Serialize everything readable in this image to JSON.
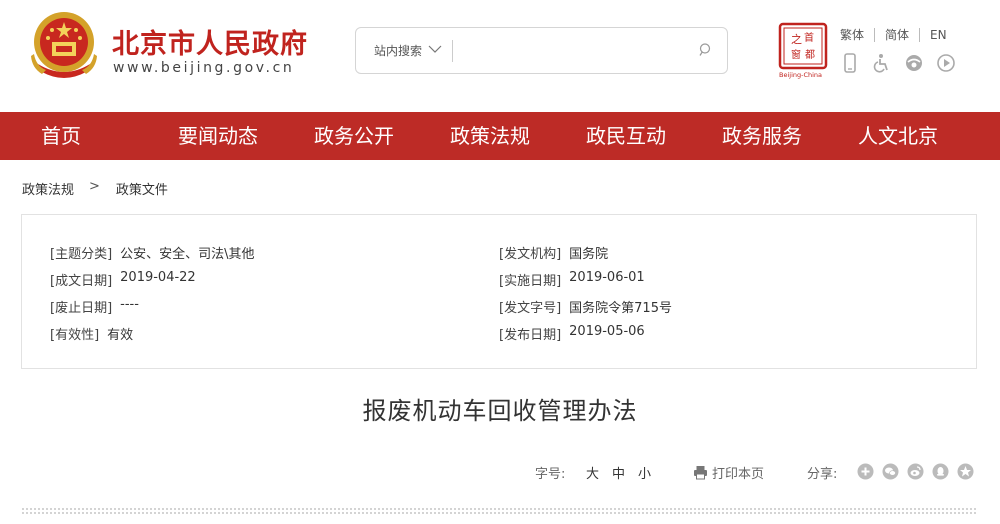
{
  "header": {
    "site_title": "北京市人民政府",
    "site_url": "www.beijing.gov.cn",
    "search": {
      "scope_label": "站内搜索",
      "placeholder": ""
    },
    "capital_logo_text": "Beijing-China",
    "languages": [
      "繁体",
      "简体",
      "EN"
    ]
  },
  "nav": {
    "items": [
      "首页",
      "要闻动态",
      "政务公开",
      "政策法规",
      "政民互动",
      "政务服务",
      "人文北京"
    ]
  },
  "breadcrumb": {
    "items": [
      "政策法规",
      "政策文件"
    ],
    "separator": ">"
  },
  "meta": {
    "left": [
      {
        "label": "[主题分类]",
        "value": "公安、安全、司法\\其他"
      },
      {
        "label": "[成文日期]",
        "value": "2019-04-22"
      },
      {
        "label": "[废止日期]",
        "value": "----"
      },
      {
        "label": "[有效性]",
        "value": "有效"
      }
    ],
    "right": [
      {
        "label": "[发文机构]",
        "value": "国务院"
      },
      {
        "label": "[实施日期]",
        "value": "2019-06-01"
      },
      {
        "label": "[发文字号]",
        "value": "国务院令第715号"
      },
      {
        "label": "[发布日期]",
        "value": "2019-05-06"
      }
    ]
  },
  "article": {
    "title": "报废机动车回收管理办法"
  },
  "toolbar": {
    "font_label": "字号:",
    "font_sizes": [
      "大",
      "中",
      "小"
    ],
    "print_label": "打印本页",
    "share_label": "分享:",
    "share_icons": [
      "share-plus-icon",
      "wechat-icon",
      "weibo-icon",
      "qq-icon",
      "qzone-icon"
    ]
  },
  "colors": {
    "brand_red": "#bd2b26",
    "title_red": "#c0231e"
  }
}
